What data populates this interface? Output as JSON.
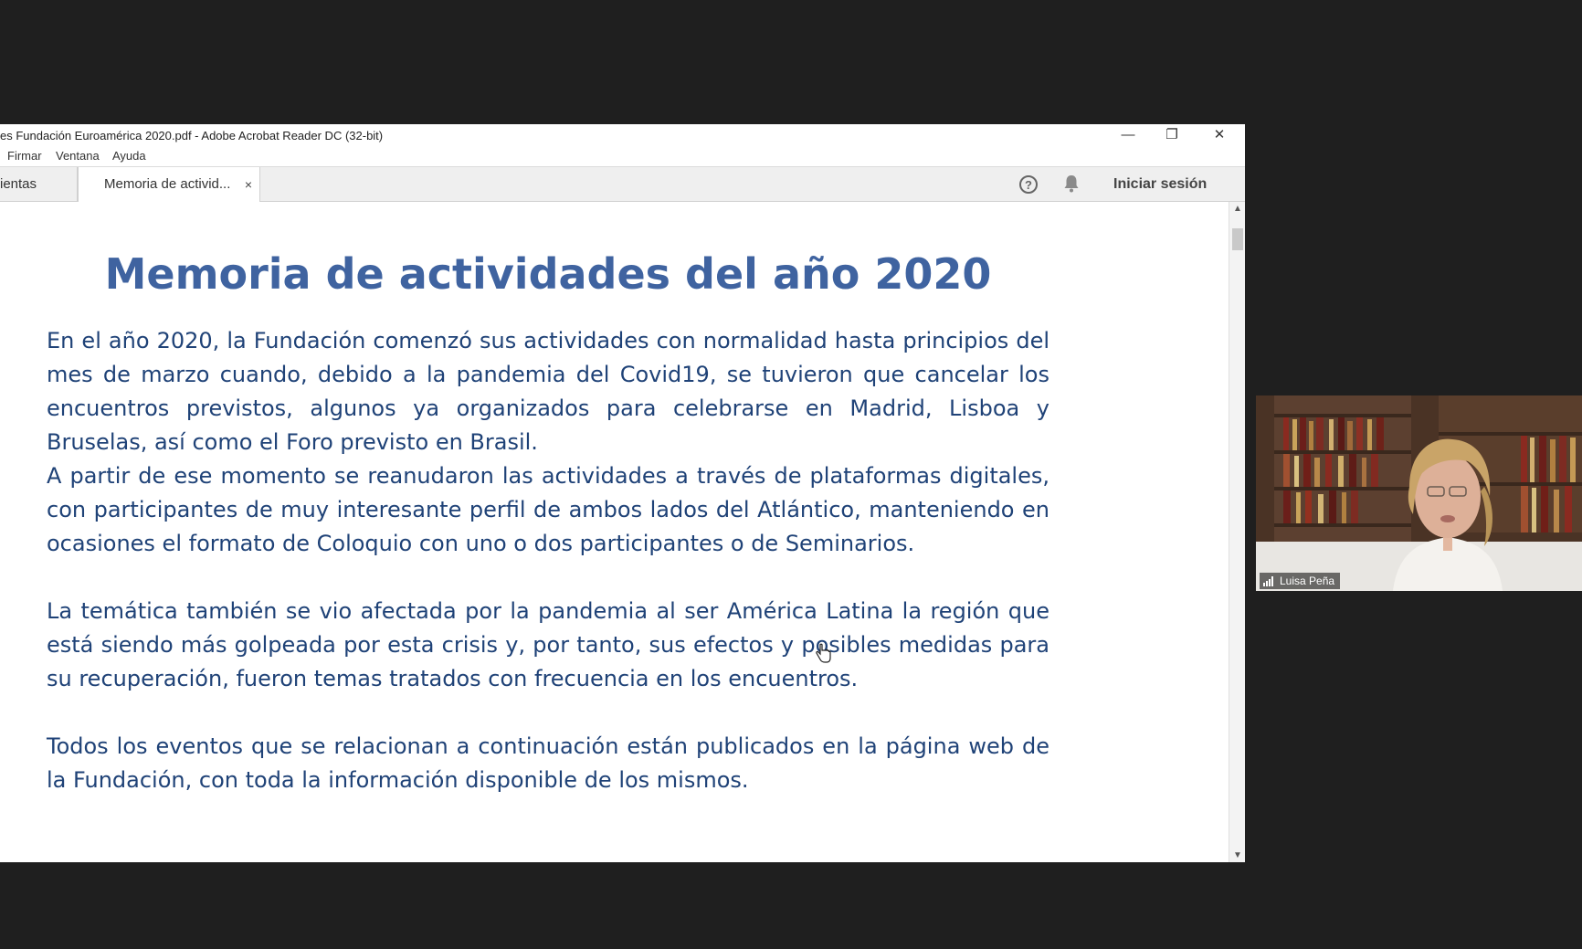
{
  "window": {
    "title": "es Fundación Euroamérica 2020.pdf - Adobe Acrobat Reader DC (32-bit)",
    "minimize": "—",
    "restore": "❐",
    "close": "✕"
  },
  "menu": {
    "items": [
      "Firmar",
      "Ventana",
      "Ayuda"
    ]
  },
  "tabs": {
    "left_label": "ientas",
    "active_label": "Memoria de activid...",
    "active_close": "×"
  },
  "toolbar": {
    "help": "?",
    "signin": "Iniciar sesión"
  },
  "document": {
    "title": "Memoria de actividades del año 2020",
    "paragraphs": [
      "En el año 2020, la Fundación  comenzó sus actividades con normalidad hasta principios del  mes de marzo cuando, debido a la pandemia del Covid19, se tuvieron que cancelar los encuentros previstos, algunos ya organizados para celebrarse en Madrid, Lisboa y Bruselas, así como el Foro previsto en Brasil.",
      "A partir de ese momento se reanudaron las actividades a través de plataformas digitales, con participantes de muy interesante perfil de ambos lados del Atlántico, manteniendo en ocasiones el formato de Coloquio con uno o dos participantes o de Seminarios.",
      "La temática también se vio afectada por la pandemia al ser América Latina la región que está siendo más golpeada por esta crisis y, por tanto, sus efectos y posibles medidas para su recuperación, fueron temas tratados con frecuencia en los encuentros.",
      "Todos los eventos que se relacionan a continuación están publicados en la página web de la Fundación, con toda la información disponible de los mismos."
    ]
  },
  "scrollbar": {
    "up": "▲",
    "down": "▼"
  },
  "video": {
    "participant_name": "Luisa Peña"
  },
  "colors": {
    "title": "#3f63a0",
    "body_text": "#1f4277",
    "background": "#1f1f1f"
  }
}
